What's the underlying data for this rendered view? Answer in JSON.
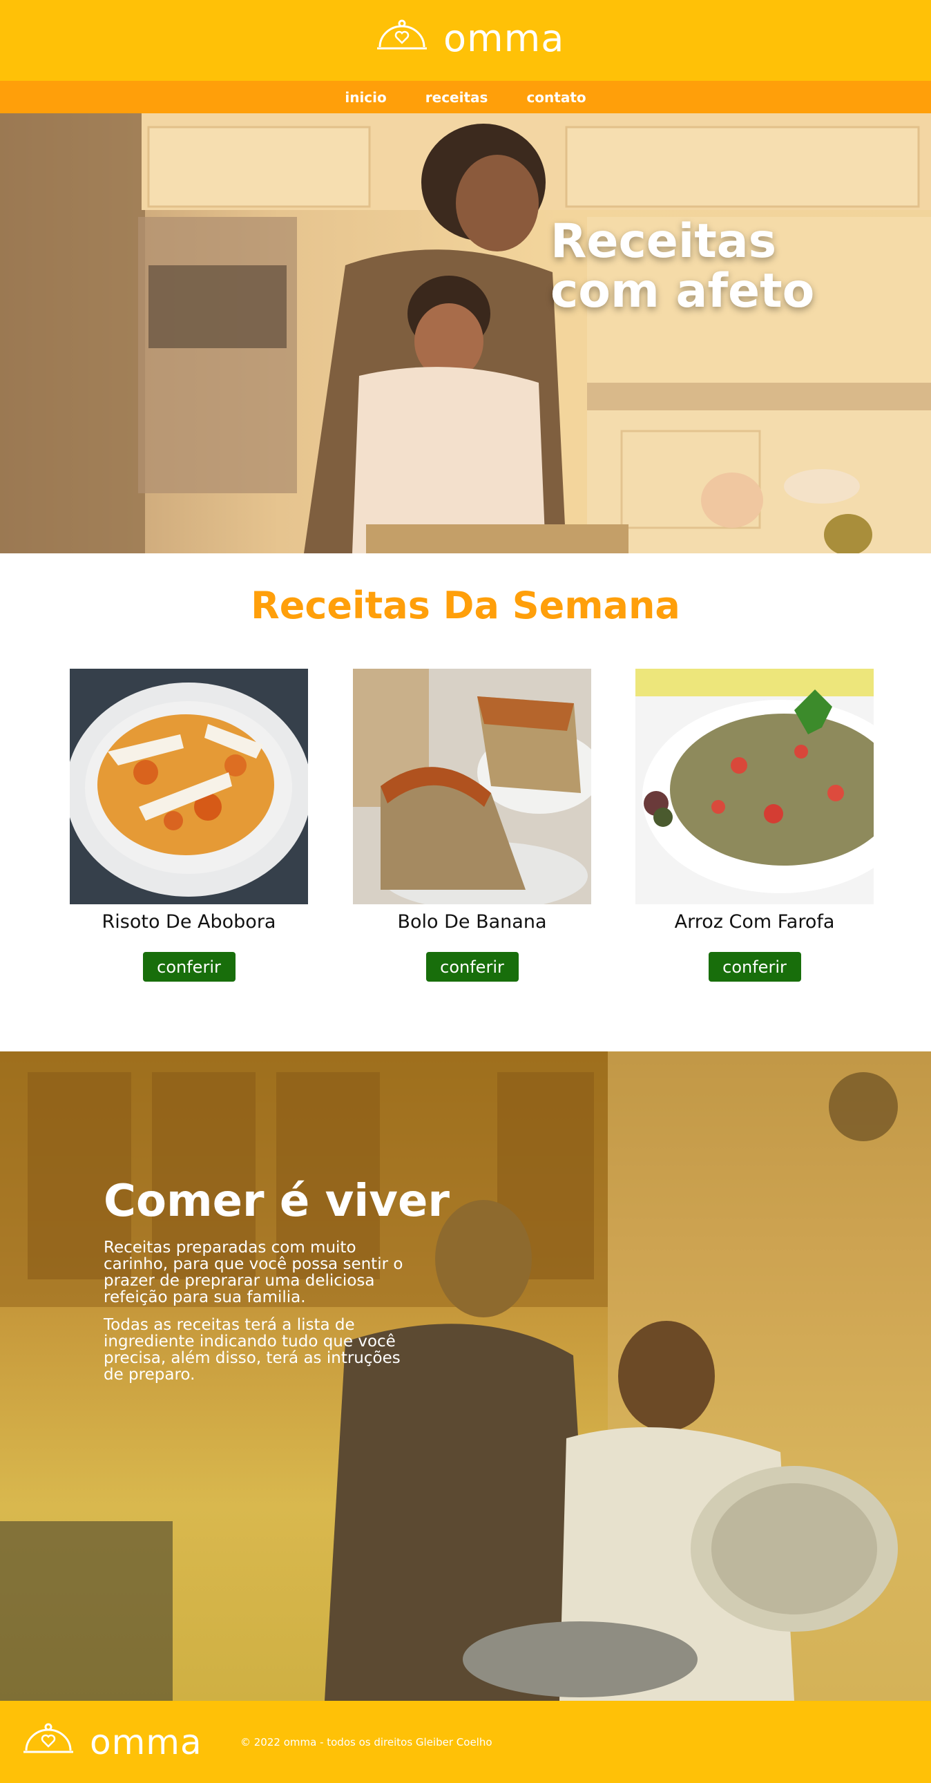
{
  "header": {
    "logo_text": "omma",
    "logo_icon": "cloche-heart-icon"
  },
  "nav": {
    "items": [
      "inicio",
      "receitas",
      "contato"
    ]
  },
  "hero": {
    "title": "Receitas\ncom afeto"
  },
  "weekly": {
    "title": "Receitas Da Semana",
    "cards": [
      {
        "name": "Risoto De Abobora",
        "button": "conferir"
      },
      {
        "name": "Bolo De Banana",
        "button": "conferir"
      },
      {
        "name": "Arroz Com Farofa",
        "button": "conferir"
      }
    ]
  },
  "about": {
    "title": "Comer é viver",
    "paragraphs": [
      "Receitas preparadas com muito carinho, para que você possa sentir o prazer de preprarar uma deliciosa refeição para sua familia.",
      "Todas as receitas terá a lista de ingrediente indicando tudo que você precisa, além disso, terá as intruções de preparo."
    ]
  },
  "footer": {
    "logo_text": "omma",
    "copyright": "© 2022 omma - todos os direitos Gleiber Coelho"
  },
  "colors": {
    "header": "#ffc107",
    "nav": "#ff9f0a",
    "accent": "#ff9f0a",
    "button": "#186e0b"
  }
}
